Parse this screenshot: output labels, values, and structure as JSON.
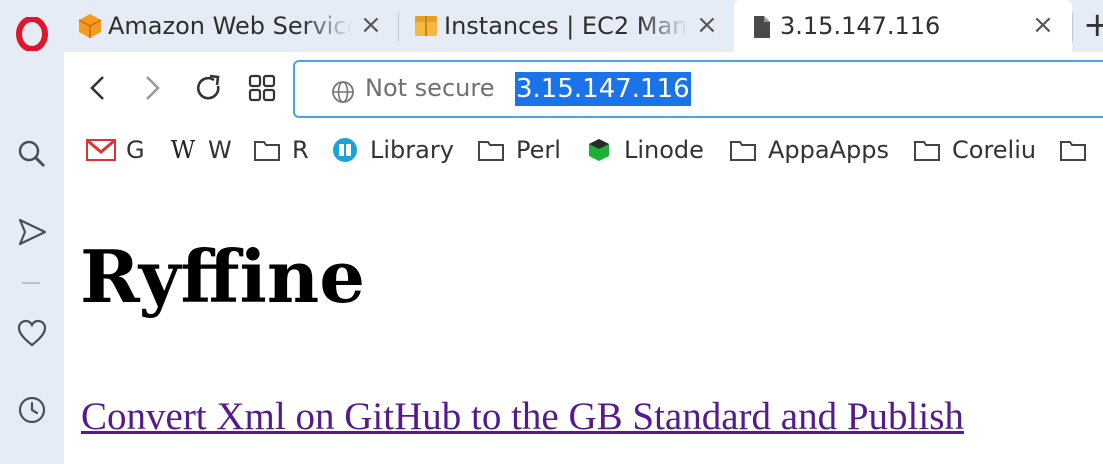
{
  "browser": {
    "tabs": [
      {
        "title": "Amazon Web Service",
        "active": false
      },
      {
        "title": "Instances | EC2 Man",
        "active": false
      },
      {
        "title": "3.15.147.116",
        "active": true
      }
    ],
    "new_tab_label": "+",
    "address_bar": {
      "security_label": "Not secure",
      "url": "3.15.147.116"
    },
    "bookmarks": [
      {
        "label": "G",
        "icon": "gmail-icon"
      },
      {
        "label": "W",
        "icon": "wikipedia-icon"
      },
      {
        "label": "R",
        "icon": "folder-icon"
      },
      {
        "label": "Library",
        "icon": "library-icon"
      },
      {
        "label": "Perl",
        "icon": "folder-icon"
      },
      {
        "label": "Linode",
        "icon": "linode-icon"
      },
      {
        "label": "AppaApps",
        "icon": "folder-icon"
      },
      {
        "label": "Coreliu",
        "icon": "folder-icon"
      }
    ],
    "sidebar_icons": [
      "opera-logo-icon",
      "search-icon",
      "send-icon",
      "heart-icon",
      "history-icon"
    ]
  },
  "page": {
    "heading": "Ryffine",
    "link_text": "Convert Xml on GitHub to the GB Standard and Publish"
  },
  "colors": {
    "chrome_bg": "#e6ecf5",
    "selection": "#1a73e8",
    "visited_link": "#551a8b",
    "opera_red": "#e0162b"
  }
}
